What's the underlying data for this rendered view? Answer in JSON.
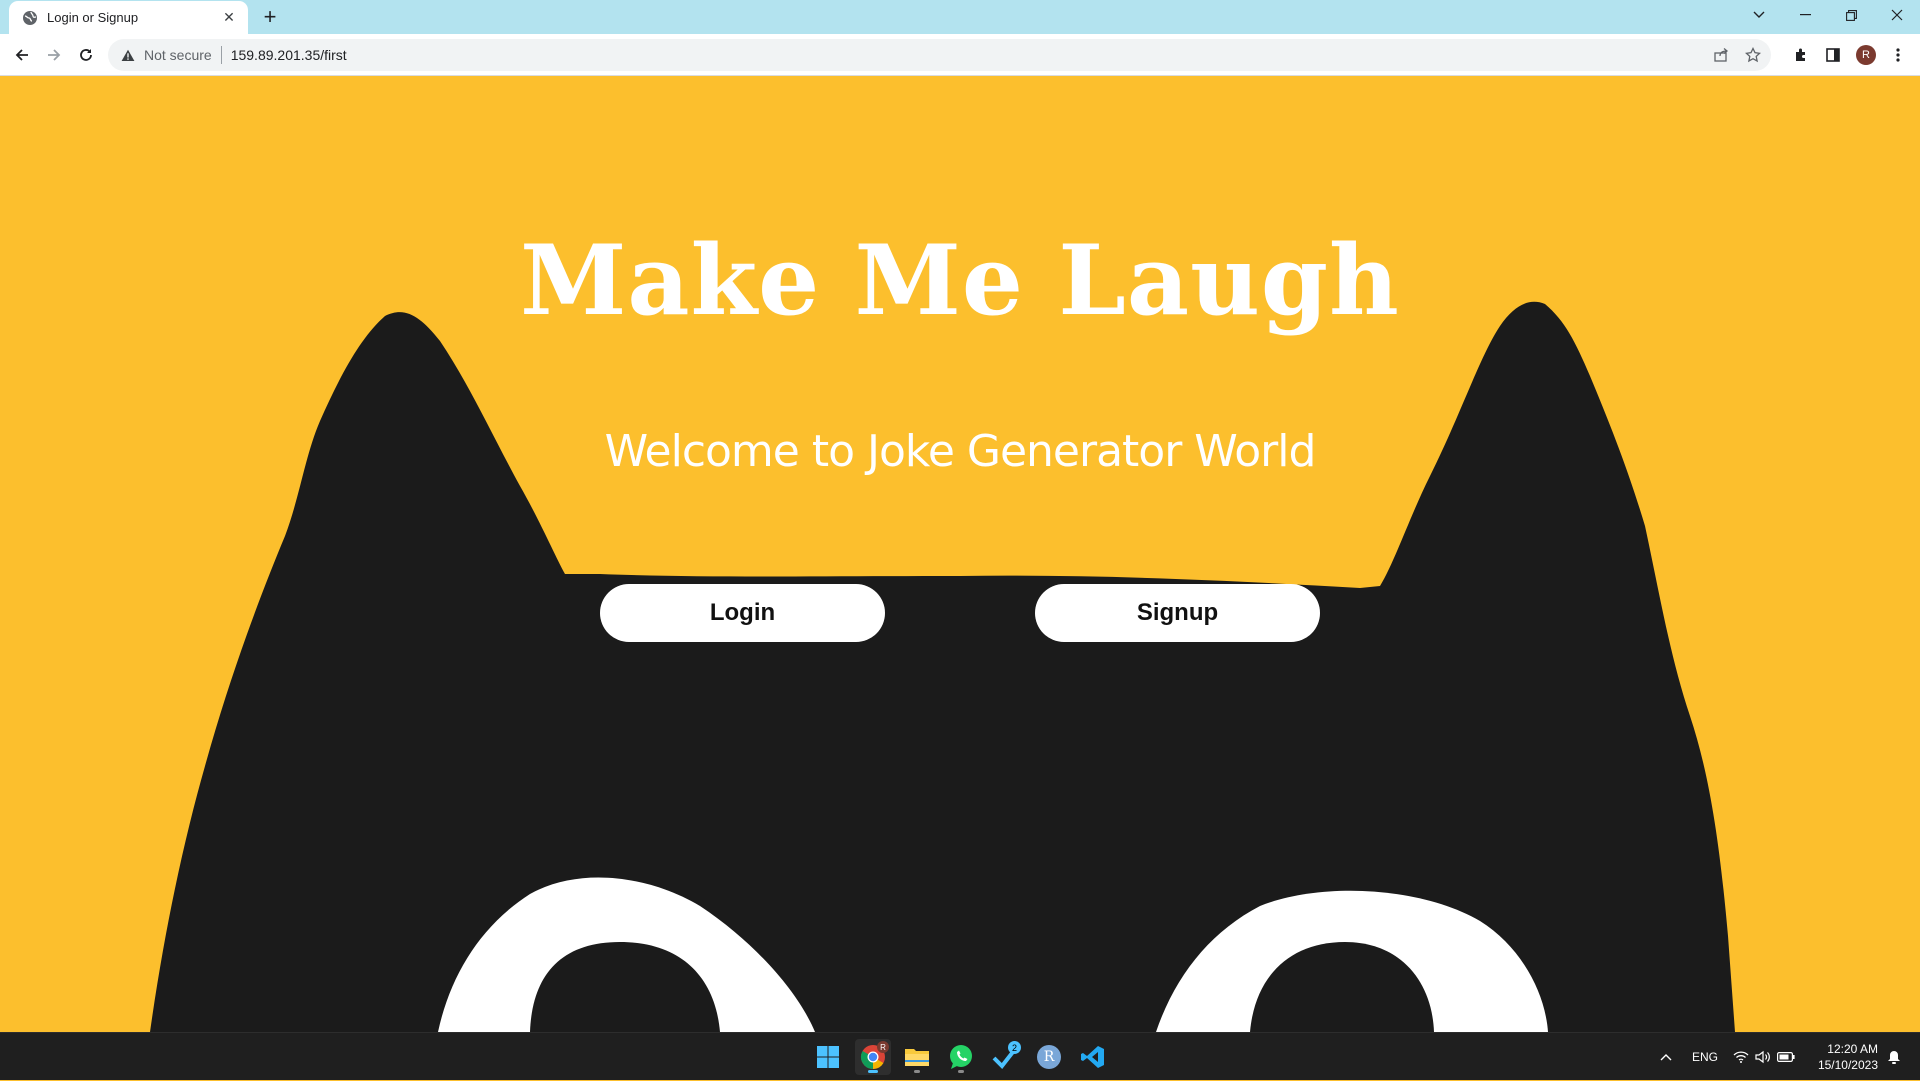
{
  "browser": {
    "tab_title": "Login or Signup",
    "tab_close": "✕",
    "new_tab": "+",
    "security_label": "Not secure",
    "url": "159.89.201.35/first",
    "profile_initial": "R"
  },
  "page": {
    "title": "Make Me Laugh",
    "subtitle": "Welcome to Joke Generator World",
    "login_label": "Login",
    "signup_label": "Signup",
    "colors": {
      "background": "#fcbf2d",
      "cat": "#1b1b1b",
      "button": "#ffffff"
    }
  },
  "taskbar": {
    "apps": [
      "windows-start",
      "chrome",
      "file-explorer",
      "whatsapp",
      "steam",
      "r-app",
      "vscode"
    ],
    "steam_badge": "2",
    "chrome_badge": "R",
    "r_app_label": "R",
    "language": "ENG",
    "time": "12:20 AM",
    "date": "15/10/2023"
  }
}
